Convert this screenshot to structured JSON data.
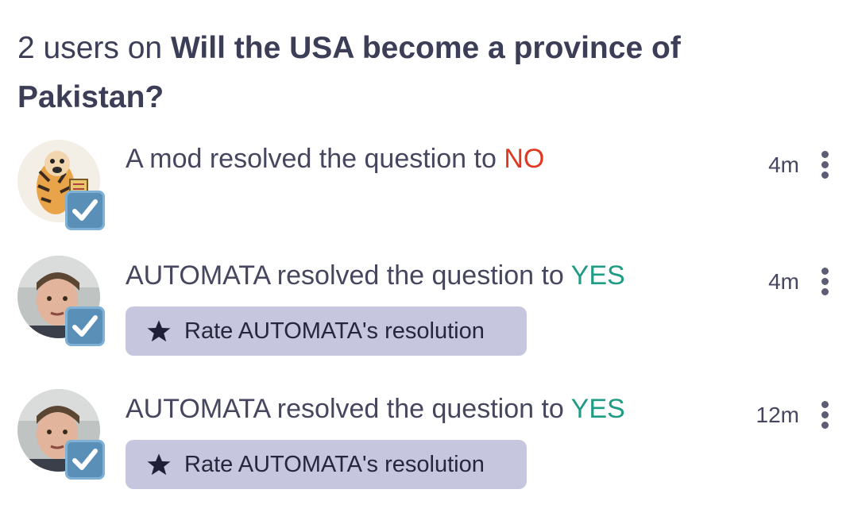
{
  "header": {
    "count_text": "2 users on ",
    "question_title": "Will the USA become a province of Pakistan?"
  },
  "events": [
    {
      "prefix": "A mod resolved the question to ",
      "outcome": "NO",
      "time": "4m",
      "avatar": "tiger-cartoon-avatar",
      "badge_icon": "check-mark-button-icon"
    },
    {
      "prefix": "AUTOMATA resolved the question to ",
      "outcome": "YES",
      "time": "4m",
      "avatar": "user-photo-avatar",
      "badge_icon": "check-mark-button-icon",
      "rate_label": "Rate AUTOMATA's resolution",
      "rate_icon": "star-icon"
    },
    {
      "prefix": "AUTOMATA resolved the question to ",
      "outcome": "YES",
      "time": "12m",
      "avatar": "user-photo-avatar",
      "badge_icon": "check-mark-button-icon",
      "rate_label": "Rate AUTOMATA's resolution",
      "rate_icon": "star-icon"
    }
  ],
  "colors": {
    "no": "#e0371f",
    "yes": "#1f9c84",
    "rate_button_bg": "#c6c6de",
    "text": "#46475f"
  }
}
